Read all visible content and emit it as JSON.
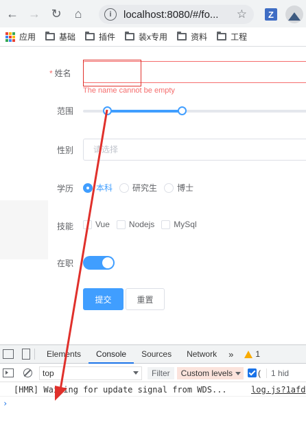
{
  "browser": {
    "url": "localhost:8080/#/fo...",
    "info_icon": "i",
    "ext_label": "Z",
    "bookmarks": [
      {
        "label": "应用",
        "icon": "apps-grid-icon"
      },
      {
        "label": "基础",
        "icon": "folder-icon"
      },
      {
        "label": "插件",
        "icon": "folder-icon"
      },
      {
        "label": "装x专用",
        "icon": "folder-icon"
      },
      {
        "label": "资料",
        "icon": "folder-icon"
      },
      {
        "label": "工程",
        "icon": "folder-icon"
      }
    ]
  },
  "form": {
    "name_label": "姓名",
    "required_mark": "*",
    "name_value": "",
    "name_error": "The name cannot be empty",
    "range_label": "范围",
    "range_value": [
      20,
      55
    ],
    "gender_label": "性别",
    "gender_placeholder": "请选择",
    "education_label": "学历",
    "education_options": [
      "本科",
      "研究生",
      "博士"
    ],
    "education_selected": "本科",
    "skills_label": "技能",
    "skills_options": [
      "Vue",
      "Nodejs",
      "MySql"
    ],
    "employed_label": "在职",
    "employed": true,
    "submit_label": "提交",
    "reset_label": "重置"
  },
  "devtools": {
    "tabs": [
      "Elements",
      "Console",
      "Sources",
      "Network"
    ],
    "active_tab": "Console",
    "more": "»",
    "warning_count": "1",
    "context": "top",
    "filter_placeholder": "Filter",
    "levels_label": "Custom levels",
    "checkbox_label": "(",
    "hidden_text": "1 hid",
    "log_message": "[HMR] Waiting for update signal from WDS...",
    "log_source": "log.js?1afd",
    "prompt_symbol": "›"
  },
  "colors": {
    "primary": "#409eff",
    "danger": "#f56c6c",
    "annotation": "#e0302b"
  }
}
